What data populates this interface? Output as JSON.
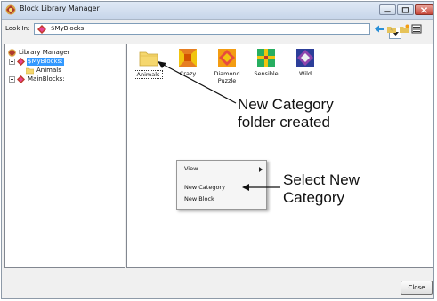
{
  "window": {
    "title": "Block Library Manager",
    "icon": "block-library-icon"
  },
  "toolbar": {
    "look_in_label": "Look In:",
    "look_in_value": "$MyBlocks:"
  },
  "tree": {
    "root": "Library Manager",
    "items": [
      {
        "label": "$MyBlocks:",
        "selected": true
      },
      {
        "label": "Animals",
        "selected": false
      },
      {
        "label": "MainBlocks:",
        "selected": false
      }
    ]
  },
  "items": [
    {
      "label": "Animals",
      "icon": "folder-icon"
    },
    {
      "label": "Crazy",
      "icon": "crazy-block-icon"
    },
    {
      "label": "Diamond Puzzle",
      "icon": "diamond-puzzle-block-icon"
    },
    {
      "label": "Sensible",
      "icon": "sensible-block-icon"
    },
    {
      "label": "Wild",
      "icon": "wild-block-icon"
    }
  ],
  "context_menu": {
    "items": [
      "View",
      "New Category",
      "New Block"
    ]
  },
  "callouts": {
    "new_category_line1": "New Category",
    "new_category_line2": "folder created",
    "select_line1": "Select New",
    "select_line2": "Category"
  },
  "footer": {
    "close_label": "Close"
  },
  "colors": {
    "selection": "#3399ff",
    "folder": "#f5d76e",
    "close_button": "#c7473a"
  }
}
